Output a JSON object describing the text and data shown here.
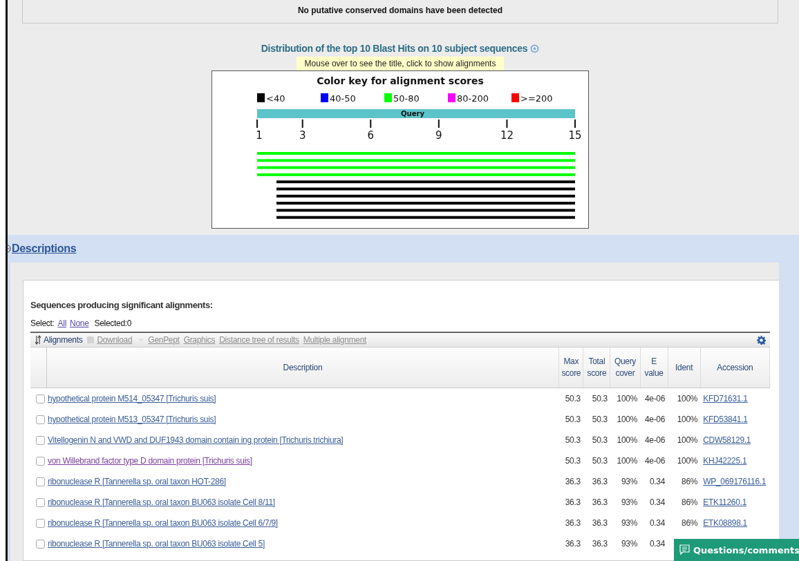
{
  "cdd_notice": "No putative conserved domains have been detected",
  "graphic": {
    "title": "Distribution of the top 10 Blast Hits on 10 subject sequences",
    "hint": "Mouse over to see the title, click to show alignments",
    "key_title": "Color key for alignment scores",
    "key": [
      {
        "label": "<40",
        "color": "#000000"
      },
      {
        "label": "40-50",
        "color": "#0000ff"
      },
      {
        "label": "50-80",
        "color": "#00ff00"
      },
      {
        "label": "80-200",
        "color": "#ff00ff"
      },
      {
        "label": ">=200",
        "color": "#ff0000"
      }
    ],
    "query_label": "Query",
    "ticks": [
      "1",
      "3",
      "6",
      "9",
      "12",
      "15"
    ],
    "hits": [
      {
        "color": "#00ff00",
        "kind": "full"
      },
      {
        "color": "#00ff00",
        "kind": "full"
      },
      {
        "color": "#00ff00",
        "kind": "full"
      },
      {
        "color": "#00ff00",
        "kind": "full"
      },
      {
        "color": "#000000",
        "kind": "offset"
      },
      {
        "color": "#000000",
        "kind": "offset"
      },
      {
        "color": "#000000",
        "kind": "offset"
      },
      {
        "color": "#000000",
        "kind": "offset"
      },
      {
        "color": "#000000",
        "kind": "offset"
      },
      {
        "color": "#000000",
        "kind": "offset"
      }
    ]
  },
  "descriptions": {
    "label": "Descriptions",
    "expanded": true
  },
  "heading": "Sequences producing significant alignments:",
  "select": {
    "label": "Select:",
    "links": [
      "All",
      "None"
    ],
    "count": "Selected:0"
  },
  "toolbar": [
    {
      "label": "Alignments",
      "kind": "sort",
      "disabled": false
    },
    {
      "label": "Download",
      "kind": "download",
      "disabled": true
    },
    {
      "label": "GenPept",
      "kind": "plain",
      "disabled": true
    },
    {
      "label": "Graphics",
      "kind": "plain",
      "disabled": true
    },
    {
      "label": "Distance tree of results",
      "kind": "plain",
      "disabled": true
    },
    {
      "label": "Multiple alignment",
      "kind": "plain",
      "disabled": true
    }
  ],
  "columns": [
    "Description",
    "Max score",
    "Total score",
    "Query cover",
    "E value",
    "Ident",
    "Accession"
  ],
  "rows": [
    {
      "checked": false,
      "visited": false,
      "description": "hypothetical protein M514_05347 [Trichuris suis]",
      "max_score": "50.3",
      "total_score": "50.3",
      "query_cover": "100%",
      "e_value": "4e-06",
      "ident": "100%",
      "accession": "KFD71631.1"
    },
    {
      "checked": false,
      "visited": false,
      "description": "hypothetical protein M513_05347 [Trichuris suis]",
      "max_score": "50.3",
      "total_score": "50.3",
      "query_cover": "100%",
      "e_value": "4e-06",
      "ident": "100%",
      "accession": "KFD53841.1"
    },
    {
      "checked": false,
      "visited": false,
      "description": "Vitellogenin N and VWD and DUF1943 domain contain ing protein [Trichuris trichiura]",
      "max_score": "50.3",
      "total_score": "50.3",
      "query_cover": "100%",
      "e_value": "4e-06",
      "ident": "100%",
      "accession": "CDW58129.1"
    },
    {
      "checked": false,
      "visited": true,
      "description": "von Willebrand factor type D domain protein [Trichuris suis]",
      "max_score": "50.3",
      "total_score": "50.3",
      "query_cover": "100%",
      "e_value": "4e-06",
      "ident": "100%",
      "accession": "KHJ42225.1"
    },
    {
      "checked": false,
      "visited": false,
      "description": "ribonuclease R [Tannerella sp. oral taxon HOT-286]",
      "max_score": "36.3",
      "total_score": "36.3",
      "query_cover": "93%",
      "e_value": "0.34",
      "ident": "86%",
      "accession": "WP_069176116.1"
    },
    {
      "checked": false,
      "visited": false,
      "description": "ribonuclease R [Tannerella sp. oral taxon BU063 isolate Cell 8/11]",
      "max_score": "36.3",
      "total_score": "36.3",
      "query_cover": "93%",
      "e_value": "0.34",
      "ident": "86%",
      "accession": "ETK11260.1"
    },
    {
      "checked": false,
      "visited": false,
      "description": "ribonuclease R [Tannerella sp. oral taxon BU063 isolate Cell 6/7/9]",
      "max_score": "36.3",
      "total_score": "36.3",
      "query_cover": "93%",
      "e_value": "0.34",
      "ident": "86%",
      "accession": "ETK08898.1"
    },
    {
      "checked": false,
      "visited": false,
      "description": "ribonuclease R [Tannerella sp. oral taxon BU063 isolate Cell 5]",
      "max_score": "36.3",
      "total_score": "36.3",
      "query_cover": "93%",
      "e_value": "0.34"
    }
  ],
  "feedback_button": "Questions/comments"
}
